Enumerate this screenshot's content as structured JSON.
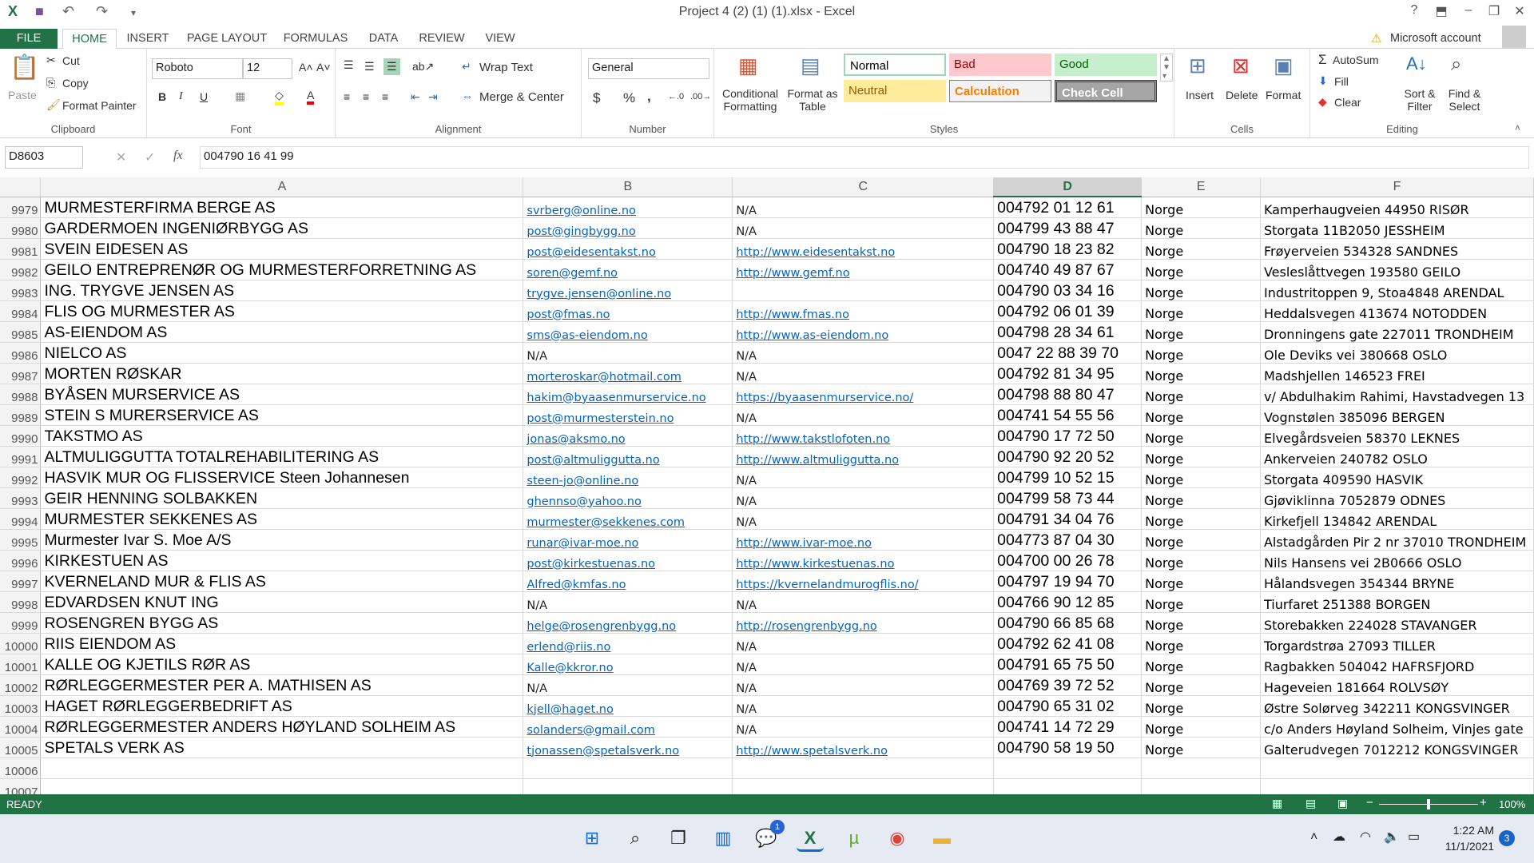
{
  "window": {
    "title": "Project 4 (2) (1) (1).xlsx - Excel",
    "account": "Microsoft account"
  },
  "tabs": [
    "FILE",
    "HOME",
    "INSERT",
    "PAGE LAYOUT",
    "FORMULAS",
    "DATA",
    "REVIEW",
    "VIEW"
  ],
  "ribbon": {
    "clipboard": {
      "label": "Clipboard",
      "paste": "Paste",
      "cut": "Cut",
      "copy": "Copy",
      "format_painter": "Format Painter"
    },
    "font": {
      "label": "Font",
      "name": "Roboto",
      "size": "12",
      "bold": "B",
      "italic": "I",
      "underline": "U"
    },
    "alignment": {
      "label": "Alignment",
      "wrap": "Wrap Text",
      "merge": "Merge & Center"
    },
    "number": {
      "label": "Number",
      "format": "General",
      "currency": "$",
      "percent": "%",
      "comma": ","
    },
    "styles": {
      "label": "Styles",
      "conditional": "Conditional Formatting",
      "format_table": "Format as Table",
      "items": [
        {
          "name": "Normal",
          "bg": "#ffffff",
          "fg": "#000000"
        },
        {
          "name": "Bad",
          "bg": "#ffc7ce",
          "fg": "#9c0006"
        },
        {
          "name": "Good",
          "bg": "#c6efce",
          "fg": "#006100"
        },
        {
          "name": "Neutral",
          "bg": "#ffeb9c",
          "fg": "#9c5700"
        },
        {
          "name": "Calculation",
          "bg": "#f2f2f2",
          "fg": "#fa7d00"
        },
        {
          "name": "Check Cell",
          "bg": "#a5a5a5",
          "fg": "#ffffff"
        }
      ]
    },
    "cells": {
      "label": "Cells",
      "insert": "Insert",
      "delete": "Delete",
      "format": "Format"
    },
    "editing": {
      "label": "Editing",
      "autosum": "AutoSum",
      "fill": "Fill",
      "clear": "Clear",
      "sort": "Sort & Filter",
      "find": "Find & Select"
    }
  },
  "formula_bar": {
    "name_box": "D8603",
    "fx": "fx",
    "value": "004790 16 41 99"
  },
  "columns": [
    "A",
    "B",
    "C",
    "D",
    "E",
    "F"
  ],
  "selected_column": "D",
  "rows": [
    {
      "n": "9979",
      "a": "MURMESTERFIRMA BERGE AS",
      "b": "svrberg@online.no",
      "c": "N/A",
      "d": "004792 01 12 61",
      "e": "Norge",
      "f": "Kamperhaugveien 44950 RISØR"
    },
    {
      "n": "9980",
      "a": "GARDERMOEN INGENIØRBYGG AS",
      "b": "post@gingbygg.no",
      "c": "N/A",
      "d": "004799 43 88 47",
      "e": "Norge",
      "f": "Storgata 11B2050 JESSHEIM"
    },
    {
      "n": "9981",
      "a": "SVEIN EIDESEN AS",
      "b": "post@eidesentakst.no",
      "c": "http://www.eidesentakst.no",
      "d": " 004790 18 23 82",
      "e": "Norge",
      "f": "Frøyerveien 534328 SANDNES"
    },
    {
      "n": "9982",
      "a": "GEILO ENTREPRENØR OG MURMESTERFORRETNING AS",
      "b": "soren@gemf.no",
      "c": "http://www.gemf.no",
      "d": "004740 49 87 67",
      "e": "Norge",
      "f": "Vesleslåttvegen 193580 GEILO"
    },
    {
      "n": "9983",
      "a": "ING. TRYGVE JENSEN AS",
      "b": "trygve.jensen@online.no",
      "c": "",
      "d": "004790 03 34 16",
      "e": "Norge",
      "f": "Industritoppen 9, Stoa4848 ARENDAL"
    },
    {
      "n": "9984",
      "a": "FLIS OG MURMESTER AS",
      "b": "post@fmas.no",
      "c": "http://www.fmas.no",
      "d": "004792 06 01 39",
      "e": "Norge",
      "f": "Heddalsvegen 413674 NOTODDEN"
    },
    {
      "n": "9985",
      "a": "AS-EIENDOM AS",
      "b": "sms@as-eiendom.no",
      "c": "http://www.as-eiendom.no",
      "d": "004798 28 34 61",
      "e": "Norge",
      "f": "Dronningens gate 227011 TRONDHEIM"
    },
    {
      "n": "9986",
      "a": "NIELCO AS",
      "b": "N/A",
      "c": "N/A",
      "d": "0047 22 88 39 70",
      "e": "Norge",
      "f": "Ole Deviks vei 380668 OSLO"
    },
    {
      "n": "9987",
      "a": "MORTEN RØSKAR",
      "b": "morteroskar@hotmail.com",
      "c": "N/A",
      "d": " 004792 81 34 95",
      "e": "Norge",
      "f": "Madshjellen 146523 FREI"
    },
    {
      "n": "9988",
      "a": "BYÅSEN MURSERVICE AS",
      "b": "hakim@byaasenmurservice.no",
      "c": "https://byaasenmurservice.no/",
      "d": "004798 88 80 47",
      "e": "Norge",
      "f": "v/ Abdulhakim Rahimi, Havstadvegen 13"
    },
    {
      "n": "9989",
      "a": "STEIN S MURERSERVICE AS",
      "b": "post@murmesterstein.no",
      "c": "N/A",
      "d": "004741 54 55 56",
      "e": "Norge",
      "f": "Vognstølen 385096 BERGEN"
    },
    {
      "n": "9990",
      "a": "TAKSTMO AS",
      "b": "jonas@aksmo.no",
      "c": "http://www.takstlofoten.no",
      "d": "004790 17 72 50",
      "e": "Norge",
      "f": "Elvegårdsveien 58370 LEKNES"
    },
    {
      "n": "9991",
      "a": "ALTMULIGGUTTA TOTALREHABILITERING AS",
      "b": "post@altmuliggutta.no",
      "c": "http://www.altmuliggutta.no",
      "d": "004790 92 20 52",
      "e": "Norge",
      "f": "Ankerveien 240782 OSLO"
    },
    {
      "n": "9992",
      "a": "HASVIK MUR OG FLISSERVICE Steen Johannesen",
      "b": "steen-jo@online.no",
      "c": "N/A",
      "d": "004799 10 52 15",
      "e": "Norge",
      "f": "Storgata 409590 HASVIK"
    },
    {
      "n": "9993",
      "a": "GEIR HENNING SOLBAKKEN",
      "b": "ghennso@yahoo.no",
      "c": "N/A",
      "d": "004799 58 73 44",
      "e": "Norge",
      "f": "Gjøviklinna 7052879 ODNES"
    },
    {
      "n": "9994",
      "a": "MURMESTER SEKKENES AS",
      "b": "murmester@sekkenes.com",
      "c": "N/A",
      "d": "004791 34 04 76",
      "e": "Norge",
      "f": "Kirkefjell 134842 ARENDAL"
    },
    {
      "n": "9995",
      "a": "Murmester Ivar S. Moe A/S",
      "b": "runar@ivar-moe.no",
      "c": "http://www.ivar-moe.no",
      "d": "004773 87 04 30",
      "e": "Norge",
      "f": "Alstadgården Pir 2 nr 37010 TRONDHEIM"
    },
    {
      "n": "9996",
      "a": "KIRKESTUEN AS",
      "b": "post@kirkestuenas.no",
      "c": "http://www.kirkestuenas.no",
      "d": "004700 00 26 78",
      "e": "Norge",
      "f": "Nils Hansens vei 2B0666 OSLO"
    },
    {
      "n": "9997",
      "a": "KVERNELAND MUR & FLIS AS",
      "b": "Alfred@kmfas.no",
      "c": "https://kvernelandmurogflis.no/",
      "d": "004797 19 94 70",
      "e": "Norge",
      "f": "Hålandsvegen 354344 BRYNE"
    },
    {
      "n": "9998",
      "a": "EDVARDSEN KNUT ING",
      "b": "N/A",
      "c": "N/A",
      "d": "004766 90 12 85",
      "e": "Norge",
      "f": "Tiurfaret 251388 BORGEN"
    },
    {
      "n": "9999",
      "a": "ROSENGREN BYGG AS",
      "b": "helge@rosengrenbygg.no",
      "c": "http://rosengrenbygg.no",
      "d": "004790 66 85 68",
      "e": "Norge",
      "f": "Storebakken 224028 STAVANGER"
    },
    {
      "n": "10000",
      "a": "RIIS EIENDOM AS",
      "b": "erlend@riis.no",
      "c": "N/A",
      "d": "004792 62 41 08",
      "e": "Norge",
      "f": "Torgardstrøa 27093 TILLER"
    },
    {
      "n": "10001",
      "a": "KALLE OG KJETILS RØR AS",
      "b": "Kalle@kkror.no",
      "c": "N/A",
      "d": "004791 65 75 50",
      "e": "Norge",
      "f": "Ragbakken 504042 HAFRSFJORD"
    },
    {
      "n": "10002",
      "a": "RØRLEGGERMESTER PER A. MATHISEN AS",
      "b": "N/A",
      "c": "N/A",
      "d": " 004769 39 72 52",
      "e": "Norge",
      "f": "Hageveien 181664 ROLVSØY"
    },
    {
      "n": "10003",
      "a": "HAGET RØRLEGGERBEDRIFT AS",
      "b": "kjell@haget.no",
      "c": "N/A",
      "d": "004790 65 31 02",
      "e": "Norge",
      "f": "Østre Solørveg 342211 KONGSVINGER"
    },
    {
      "n": "10004",
      "a": "RØRLEGGERMESTER ANDERS HØYLAND SOLHEIM AS",
      "b": "solanders@gmail.com",
      "c": "N/A",
      "d": "004741 14 72 29",
      "e": "Norge",
      "f": "c/o Anders Høyland Solheim, Vinjes gate"
    },
    {
      "n": "10005",
      "a": "SPETALS VERK AS",
      "b": "tjonassen@spetalsverk.no",
      "c": "http://www.spetalsverk.no",
      "d": "004790 58 19 50",
      "e": "Norge",
      "f": "Galterudvegen 7012212 KONGSVINGER"
    },
    {
      "n": "10006",
      "a": "",
      "b": "",
      "c": "",
      "d": "",
      "e": "",
      "f": ""
    },
    {
      "n": "10007",
      "a": "",
      "b": "",
      "c": "",
      "d": "",
      "e": "",
      "f": ""
    }
  ],
  "status": {
    "ready": "READY",
    "zoom": "100%",
    "zoom_level": 100
  },
  "taskbar": {
    "time": "1:22 AM",
    "date": "11/1/2021",
    "teams_badge": "1",
    "notifications": "3"
  }
}
